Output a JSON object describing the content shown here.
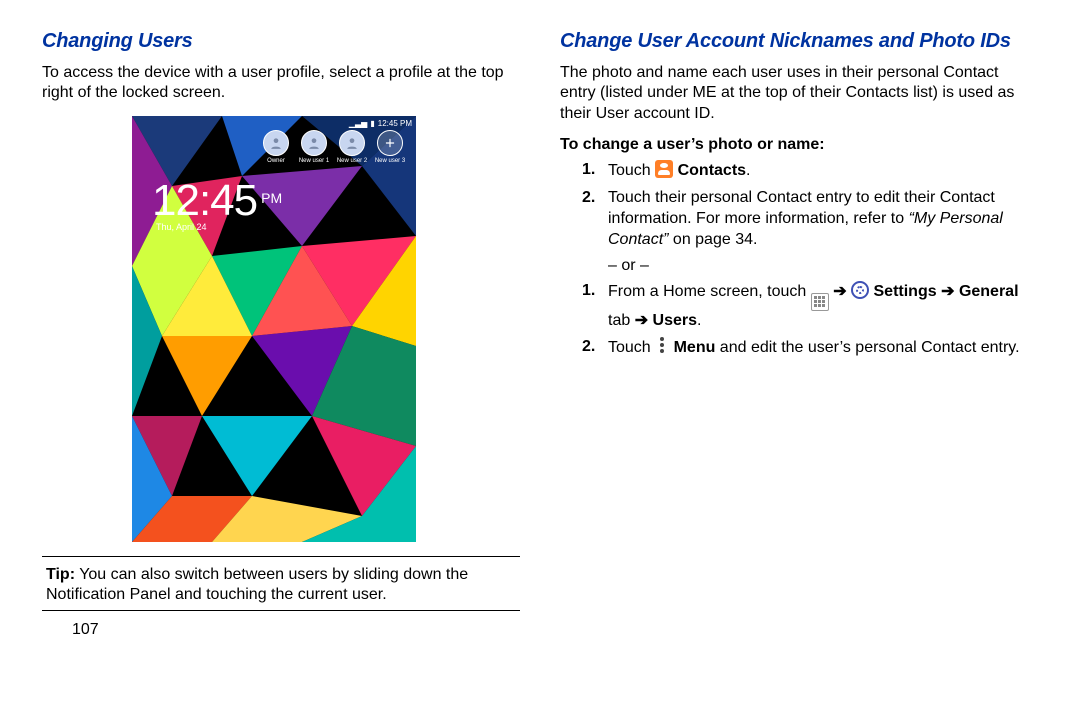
{
  "left": {
    "heading": "Changing Users",
    "intro": "To access the device with a user profile, select a profile at the top right of the locked screen.",
    "lockscreen": {
      "status_time": "12:45 PM",
      "users": [
        {
          "label": "Owner"
        },
        {
          "label": "New user 1"
        },
        {
          "label": "New user 2"
        },
        {
          "label": "New user 3"
        }
      ],
      "clock_time": "12:45",
      "clock_ampm": "PM",
      "clock_date": "Thu, April 24"
    },
    "tip_label": "Tip:",
    "tip_text": " You can also switch between users by sliding down the Notification Panel and touching the current user."
  },
  "right": {
    "heading": "Change User Account Nicknames and Photo IDs",
    "intro": "The photo and name each user uses in their personal Contact entry (listed under ME at the top of their Contacts list) is used as their User account ID.",
    "subhead": "To change a user’s photo or name:",
    "step1_num": "1.",
    "step1_a": "Touch ",
    "step1_b": " Contacts",
    "step1_c": ".",
    "step2_num": "2.",
    "step2_a": "Touch their personal Contact entry to edit their Contact information. For more information, refer to ",
    "step2_b": "“My Personal Contact”",
    "step2_c": " on page 34.",
    "or": "– or –",
    "step3_num": "1.",
    "step3_a": "From a Home screen, touch ",
    "step3_b": " Settings ",
    "step3_c": "General",
    "step3_d": " tab ",
    "step3_e": " Users",
    "step3_f": ".",
    "step4_num": "2.",
    "step4_a": "Touch ",
    "step4_b": " Menu",
    "step4_c": " and edit the user’s personal Contact entry."
  },
  "page_number": "107",
  "arrow": "➔"
}
